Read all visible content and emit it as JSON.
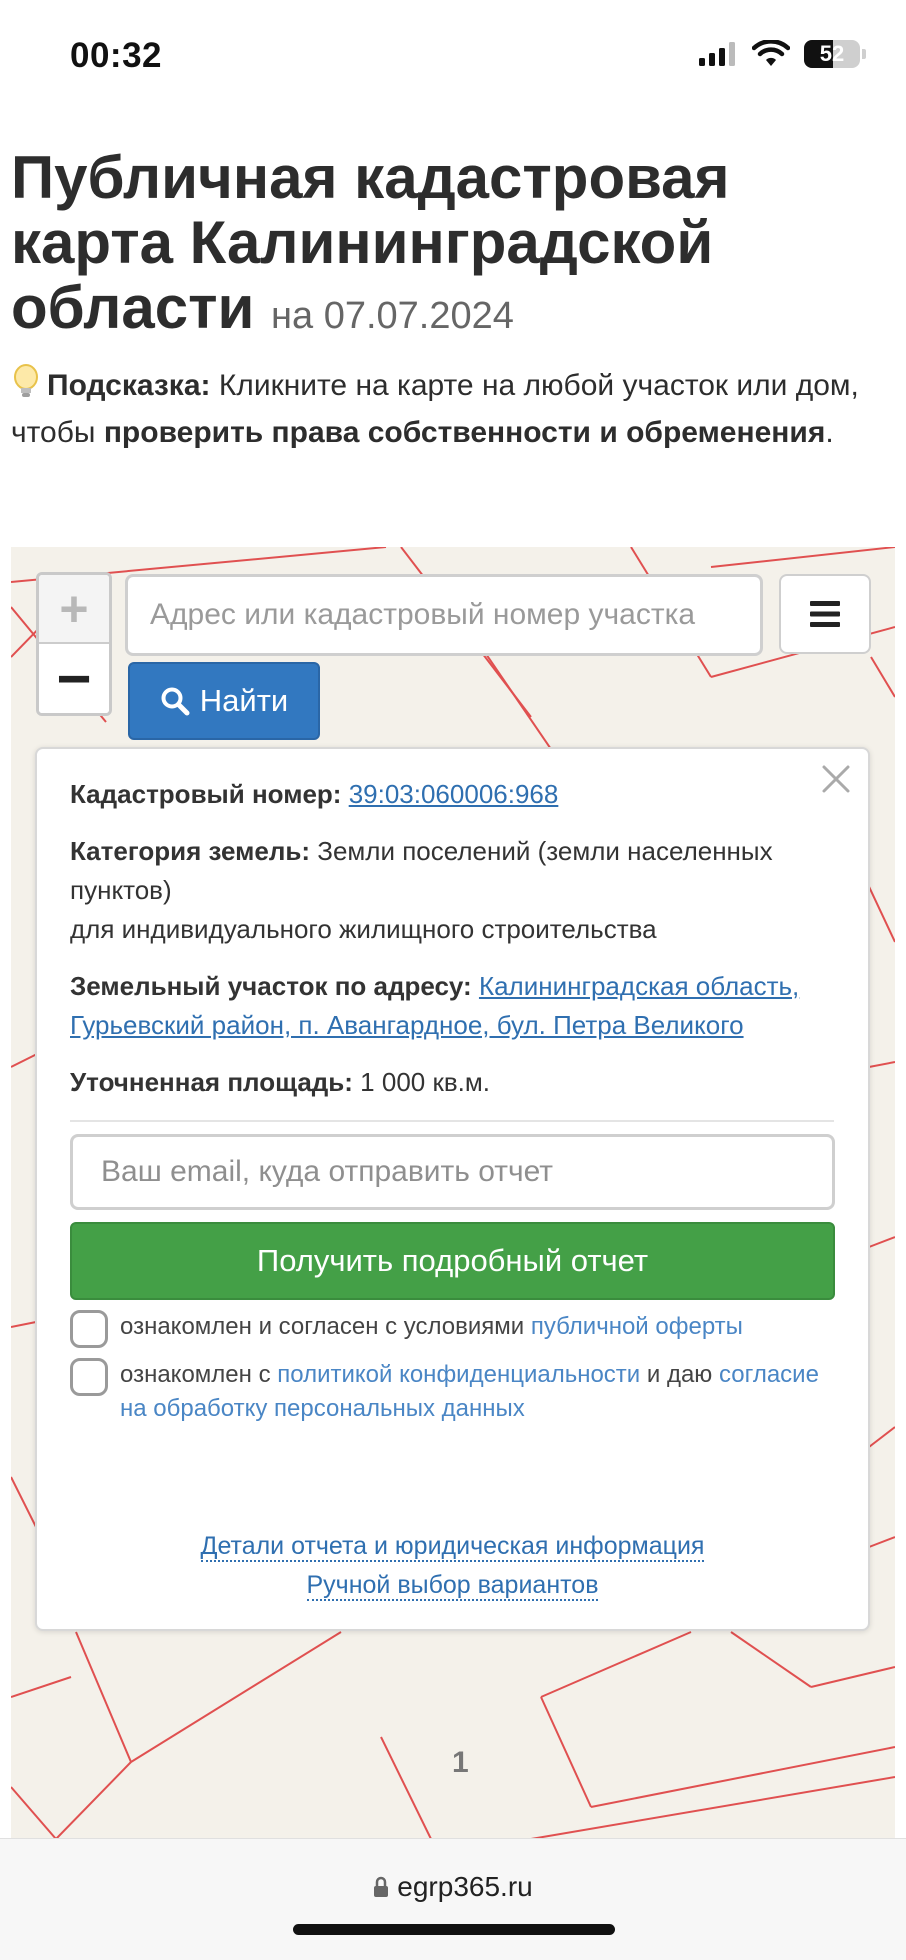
{
  "status": {
    "time": "00:32",
    "battery": "52",
    "battery_level": 0.52
  },
  "heading": {
    "title": "Публичная кадастровая карта Калининградской области",
    "date": "на 07.07.2024"
  },
  "hint": {
    "label": "Подсказка:",
    "text1": " Кликните на карте на любой участок или дом, чтобы ",
    "bold": "проверить права собственности и обременения",
    "text2": "."
  },
  "map": {
    "zoom_in": "+",
    "zoom_out": "−",
    "search_placeholder": "Адрес или кадастровый номер участка",
    "find_label": "Найти",
    "page_number": "1"
  },
  "popup": {
    "cad_label": "Кадастровый номер:",
    "cad_value": "39:03:060006:968",
    "category_label": "Категория земель:",
    "category_value": " Земли поселений (земли населенных пунктов)",
    "use": "для индивидуального жилищного строительства",
    "address_label": "Земельный участок по адресу:",
    "address_value": "Калининградская область, Гурьевский район, п. Авангардное, бул. Петра Великого",
    "area_label": "Уточненная площадь:",
    "area_value": " 1 000 кв.м.",
    "email_placeholder": "Ваш email, куда отправить отчет",
    "report_button": "Получить подробный отчет",
    "agree1_text": "ознакомлен и согласен с условиями ",
    "agree1_link": "публичной оферты",
    "agree2_text1": "ознакомлен с ",
    "agree2_link1": "политикой конфиденциальности",
    "agree2_text2": " и даю ",
    "agree2_link2": "согласие на обработку персональных данных",
    "details_link": "Детали отчета и юридическая информация",
    "manual_link": "Ручной выбор вариантов"
  },
  "browser": {
    "url": "egrp365.ru"
  },
  "colors": {
    "cadastre_line": "#e05050",
    "find_button": "#3278c0",
    "report_button": "#44a047",
    "link": "#2f6fb0"
  }
}
